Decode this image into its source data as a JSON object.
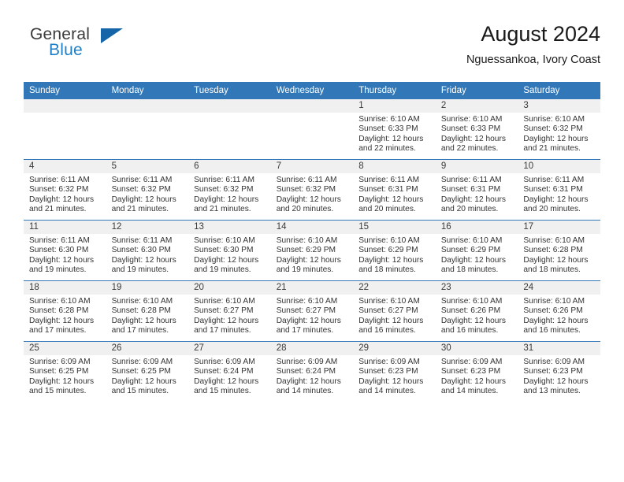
{
  "brand": {
    "name_line1": "General",
    "name_line2": "Blue",
    "logo_icon": "triangle-logo-icon",
    "colors": {
      "blue": "#1f7fc4",
      "dark_blue": "#1565a8",
      "text": "#3b3b3b"
    }
  },
  "header": {
    "title": "August 2024",
    "subtitle": "Nguessankoa, Ivory Coast"
  },
  "colors": {
    "header_row_bg": "#3278b8",
    "daynum_bg": "#f0f0f0",
    "cell_bg": "#ffffff",
    "grid_line": "#3278b8",
    "body_text": "#333333"
  },
  "weekdays": [
    "Sunday",
    "Monday",
    "Tuesday",
    "Wednesday",
    "Thursday",
    "Friday",
    "Saturday"
  ],
  "weeks": [
    [
      {
        "day": "",
        "lines": []
      },
      {
        "day": "",
        "lines": []
      },
      {
        "day": "",
        "lines": []
      },
      {
        "day": "",
        "lines": []
      },
      {
        "day": "1",
        "lines": [
          "Sunrise: 6:10 AM",
          "Sunset: 6:33 PM",
          "Daylight: 12 hours",
          "and 22 minutes."
        ]
      },
      {
        "day": "2",
        "lines": [
          "Sunrise: 6:10 AM",
          "Sunset: 6:33 PM",
          "Daylight: 12 hours",
          "and 22 minutes."
        ]
      },
      {
        "day": "3",
        "lines": [
          "Sunrise: 6:10 AM",
          "Sunset: 6:32 PM",
          "Daylight: 12 hours",
          "and 21 minutes."
        ]
      }
    ],
    [
      {
        "day": "4",
        "lines": [
          "Sunrise: 6:11 AM",
          "Sunset: 6:32 PM",
          "Daylight: 12 hours",
          "and 21 minutes."
        ]
      },
      {
        "day": "5",
        "lines": [
          "Sunrise: 6:11 AM",
          "Sunset: 6:32 PM",
          "Daylight: 12 hours",
          "and 21 minutes."
        ]
      },
      {
        "day": "6",
        "lines": [
          "Sunrise: 6:11 AM",
          "Sunset: 6:32 PM",
          "Daylight: 12 hours",
          "and 21 minutes."
        ]
      },
      {
        "day": "7",
        "lines": [
          "Sunrise: 6:11 AM",
          "Sunset: 6:32 PM",
          "Daylight: 12 hours",
          "and 20 minutes."
        ]
      },
      {
        "day": "8",
        "lines": [
          "Sunrise: 6:11 AM",
          "Sunset: 6:31 PM",
          "Daylight: 12 hours",
          "and 20 minutes."
        ]
      },
      {
        "day": "9",
        "lines": [
          "Sunrise: 6:11 AM",
          "Sunset: 6:31 PM",
          "Daylight: 12 hours",
          "and 20 minutes."
        ]
      },
      {
        "day": "10",
        "lines": [
          "Sunrise: 6:11 AM",
          "Sunset: 6:31 PM",
          "Daylight: 12 hours",
          "and 20 minutes."
        ]
      }
    ],
    [
      {
        "day": "11",
        "lines": [
          "Sunrise: 6:11 AM",
          "Sunset: 6:30 PM",
          "Daylight: 12 hours",
          "and 19 minutes."
        ]
      },
      {
        "day": "12",
        "lines": [
          "Sunrise: 6:11 AM",
          "Sunset: 6:30 PM",
          "Daylight: 12 hours",
          "and 19 minutes."
        ]
      },
      {
        "day": "13",
        "lines": [
          "Sunrise: 6:10 AM",
          "Sunset: 6:30 PM",
          "Daylight: 12 hours",
          "and 19 minutes."
        ]
      },
      {
        "day": "14",
        "lines": [
          "Sunrise: 6:10 AM",
          "Sunset: 6:29 PM",
          "Daylight: 12 hours",
          "and 19 minutes."
        ]
      },
      {
        "day": "15",
        "lines": [
          "Sunrise: 6:10 AM",
          "Sunset: 6:29 PM",
          "Daylight: 12 hours",
          "and 18 minutes."
        ]
      },
      {
        "day": "16",
        "lines": [
          "Sunrise: 6:10 AM",
          "Sunset: 6:29 PM",
          "Daylight: 12 hours",
          "and 18 minutes."
        ]
      },
      {
        "day": "17",
        "lines": [
          "Sunrise: 6:10 AM",
          "Sunset: 6:28 PM",
          "Daylight: 12 hours",
          "and 18 minutes."
        ]
      }
    ],
    [
      {
        "day": "18",
        "lines": [
          "Sunrise: 6:10 AM",
          "Sunset: 6:28 PM",
          "Daylight: 12 hours",
          "and 17 minutes."
        ]
      },
      {
        "day": "19",
        "lines": [
          "Sunrise: 6:10 AM",
          "Sunset: 6:28 PM",
          "Daylight: 12 hours",
          "and 17 minutes."
        ]
      },
      {
        "day": "20",
        "lines": [
          "Sunrise: 6:10 AM",
          "Sunset: 6:27 PM",
          "Daylight: 12 hours",
          "and 17 minutes."
        ]
      },
      {
        "day": "21",
        "lines": [
          "Sunrise: 6:10 AM",
          "Sunset: 6:27 PM",
          "Daylight: 12 hours",
          "and 17 minutes."
        ]
      },
      {
        "day": "22",
        "lines": [
          "Sunrise: 6:10 AM",
          "Sunset: 6:27 PM",
          "Daylight: 12 hours",
          "and 16 minutes."
        ]
      },
      {
        "day": "23",
        "lines": [
          "Sunrise: 6:10 AM",
          "Sunset: 6:26 PM",
          "Daylight: 12 hours",
          "and 16 minutes."
        ]
      },
      {
        "day": "24",
        "lines": [
          "Sunrise: 6:10 AM",
          "Sunset: 6:26 PM",
          "Daylight: 12 hours",
          "and 16 minutes."
        ]
      }
    ],
    [
      {
        "day": "25",
        "lines": [
          "Sunrise: 6:09 AM",
          "Sunset: 6:25 PM",
          "Daylight: 12 hours",
          "and 15 minutes."
        ]
      },
      {
        "day": "26",
        "lines": [
          "Sunrise: 6:09 AM",
          "Sunset: 6:25 PM",
          "Daylight: 12 hours",
          "and 15 minutes."
        ]
      },
      {
        "day": "27",
        "lines": [
          "Sunrise: 6:09 AM",
          "Sunset: 6:24 PM",
          "Daylight: 12 hours",
          "and 15 minutes."
        ]
      },
      {
        "day": "28",
        "lines": [
          "Sunrise: 6:09 AM",
          "Sunset: 6:24 PM",
          "Daylight: 12 hours",
          "and 14 minutes."
        ]
      },
      {
        "day": "29",
        "lines": [
          "Sunrise: 6:09 AM",
          "Sunset: 6:23 PM",
          "Daylight: 12 hours",
          "and 14 minutes."
        ]
      },
      {
        "day": "30",
        "lines": [
          "Sunrise: 6:09 AM",
          "Sunset: 6:23 PM",
          "Daylight: 12 hours",
          "and 14 minutes."
        ]
      },
      {
        "day": "31",
        "lines": [
          "Sunrise: 6:09 AM",
          "Sunset: 6:23 PM",
          "Daylight: 12 hours",
          "and 13 minutes."
        ]
      }
    ]
  ]
}
